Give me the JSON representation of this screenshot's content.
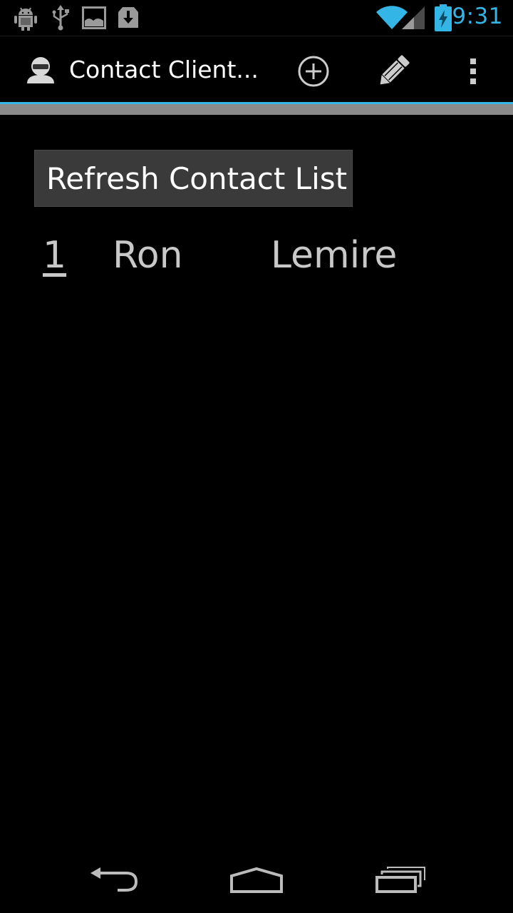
{
  "status_bar": {
    "time": "9:31",
    "notification_icons": [
      "android-debug-icon",
      "usb-icon",
      "image-icon",
      "download-icon"
    ],
    "wifi": "wifi-icon",
    "signal": "signal-icon",
    "battery": "battery-charging-icon",
    "accent_color": "#33b5e5"
  },
  "action_bar": {
    "title": "Contact Client...",
    "actions": [
      "add-icon",
      "edit-icon",
      "overflow-menu-icon"
    ]
  },
  "main": {
    "refresh_label": "Refresh Contact List",
    "contacts": [
      {
        "id": "1",
        "first_name": "Ron",
        "last_name": "Lemire"
      }
    ]
  },
  "nav_bar": {
    "buttons": [
      "back-icon",
      "home-icon",
      "recents-icon"
    ]
  }
}
